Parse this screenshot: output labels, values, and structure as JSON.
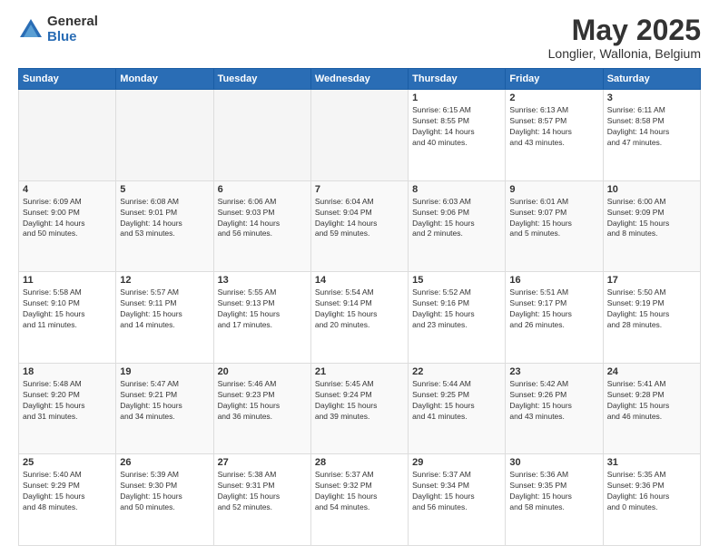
{
  "header": {
    "logo_general": "General",
    "logo_blue": "Blue",
    "title": "May 2025",
    "subtitle": "Longlier, Wallonia, Belgium"
  },
  "calendar": {
    "days_of_week": [
      "Sunday",
      "Monday",
      "Tuesday",
      "Wednesday",
      "Thursday",
      "Friday",
      "Saturday"
    ],
    "weeks": [
      [
        {
          "day": "",
          "info": ""
        },
        {
          "day": "",
          "info": ""
        },
        {
          "day": "",
          "info": ""
        },
        {
          "day": "",
          "info": ""
        },
        {
          "day": "1",
          "info": "Sunrise: 6:15 AM\nSunset: 8:55 PM\nDaylight: 14 hours\nand 40 minutes."
        },
        {
          "day": "2",
          "info": "Sunrise: 6:13 AM\nSunset: 8:57 PM\nDaylight: 14 hours\nand 43 minutes."
        },
        {
          "day": "3",
          "info": "Sunrise: 6:11 AM\nSunset: 8:58 PM\nDaylight: 14 hours\nand 47 minutes."
        }
      ],
      [
        {
          "day": "4",
          "info": "Sunrise: 6:09 AM\nSunset: 9:00 PM\nDaylight: 14 hours\nand 50 minutes."
        },
        {
          "day": "5",
          "info": "Sunrise: 6:08 AM\nSunset: 9:01 PM\nDaylight: 14 hours\nand 53 minutes."
        },
        {
          "day": "6",
          "info": "Sunrise: 6:06 AM\nSunset: 9:03 PM\nDaylight: 14 hours\nand 56 minutes."
        },
        {
          "day": "7",
          "info": "Sunrise: 6:04 AM\nSunset: 9:04 PM\nDaylight: 14 hours\nand 59 minutes."
        },
        {
          "day": "8",
          "info": "Sunrise: 6:03 AM\nSunset: 9:06 PM\nDaylight: 15 hours\nand 2 minutes."
        },
        {
          "day": "9",
          "info": "Sunrise: 6:01 AM\nSunset: 9:07 PM\nDaylight: 15 hours\nand 5 minutes."
        },
        {
          "day": "10",
          "info": "Sunrise: 6:00 AM\nSunset: 9:09 PM\nDaylight: 15 hours\nand 8 minutes."
        }
      ],
      [
        {
          "day": "11",
          "info": "Sunrise: 5:58 AM\nSunset: 9:10 PM\nDaylight: 15 hours\nand 11 minutes."
        },
        {
          "day": "12",
          "info": "Sunrise: 5:57 AM\nSunset: 9:11 PM\nDaylight: 15 hours\nand 14 minutes."
        },
        {
          "day": "13",
          "info": "Sunrise: 5:55 AM\nSunset: 9:13 PM\nDaylight: 15 hours\nand 17 minutes."
        },
        {
          "day": "14",
          "info": "Sunrise: 5:54 AM\nSunset: 9:14 PM\nDaylight: 15 hours\nand 20 minutes."
        },
        {
          "day": "15",
          "info": "Sunrise: 5:52 AM\nSunset: 9:16 PM\nDaylight: 15 hours\nand 23 minutes."
        },
        {
          "day": "16",
          "info": "Sunrise: 5:51 AM\nSunset: 9:17 PM\nDaylight: 15 hours\nand 26 minutes."
        },
        {
          "day": "17",
          "info": "Sunrise: 5:50 AM\nSunset: 9:19 PM\nDaylight: 15 hours\nand 28 minutes."
        }
      ],
      [
        {
          "day": "18",
          "info": "Sunrise: 5:48 AM\nSunset: 9:20 PM\nDaylight: 15 hours\nand 31 minutes."
        },
        {
          "day": "19",
          "info": "Sunrise: 5:47 AM\nSunset: 9:21 PM\nDaylight: 15 hours\nand 34 minutes."
        },
        {
          "day": "20",
          "info": "Sunrise: 5:46 AM\nSunset: 9:23 PM\nDaylight: 15 hours\nand 36 minutes."
        },
        {
          "day": "21",
          "info": "Sunrise: 5:45 AM\nSunset: 9:24 PM\nDaylight: 15 hours\nand 39 minutes."
        },
        {
          "day": "22",
          "info": "Sunrise: 5:44 AM\nSunset: 9:25 PM\nDaylight: 15 hours\nand 41 minutes."
        },
        {
          "day": "23",
          "info": "Sunrise: 5:42 AM\nSunset: 9:26 PM\nDaylight: 15 hours\nand 43 minutes."
        },
        {
          "day": "24",
          "info": "Sunrise: 5:41 AM\nSunset: 9:28 PM\nDaylight: 15 hours\nand 46 minutes."
        }
      ],
      [
        {
          "day": "25",
          "info": "Sunrise: 5:40 AM\nSunset: 9:29 PM\nDaylight: 15 hours\nand 48 minutes."
        },
        {
          "day": "26",
          "info": "Sunrise: 5:39 AM\nSunset: 9:30 PM\nDaylight: 15 hours\nand 50 minutes."
        },
        {
          "day": "27",
          "info": "Sunrise: 5:38 AM\nSunset: 9:31 PM\nDaylight: 15 hours\nand 52 minutes."
        },
        {
          "day": "28",
          "info": "Sunrise: 5:37 AM\nSunset: 9:32 PM\nDaylight: 15 hours\nand 54 minutes."
        },
        {
          "day": "29",
          "info": "Sunrise: 5:37 AM\nSunset: 9:34 PM\nDaylight: 15 hours\nand 56 minutes."
        },
        {
          "day": "30",
          "info": "Sunrise: 5:36 AM\nSunset: 9:35 PM\nDaylight: 15 hours\nand 58 minutes."
        },
        {
          "day": "31",
          "info": "Sunrise: 5:35 AM\nSunset: 9:36 PM\nDaylight: 16 hours\nand 0 minutes."
        }
      ]
    ]
  }
}
